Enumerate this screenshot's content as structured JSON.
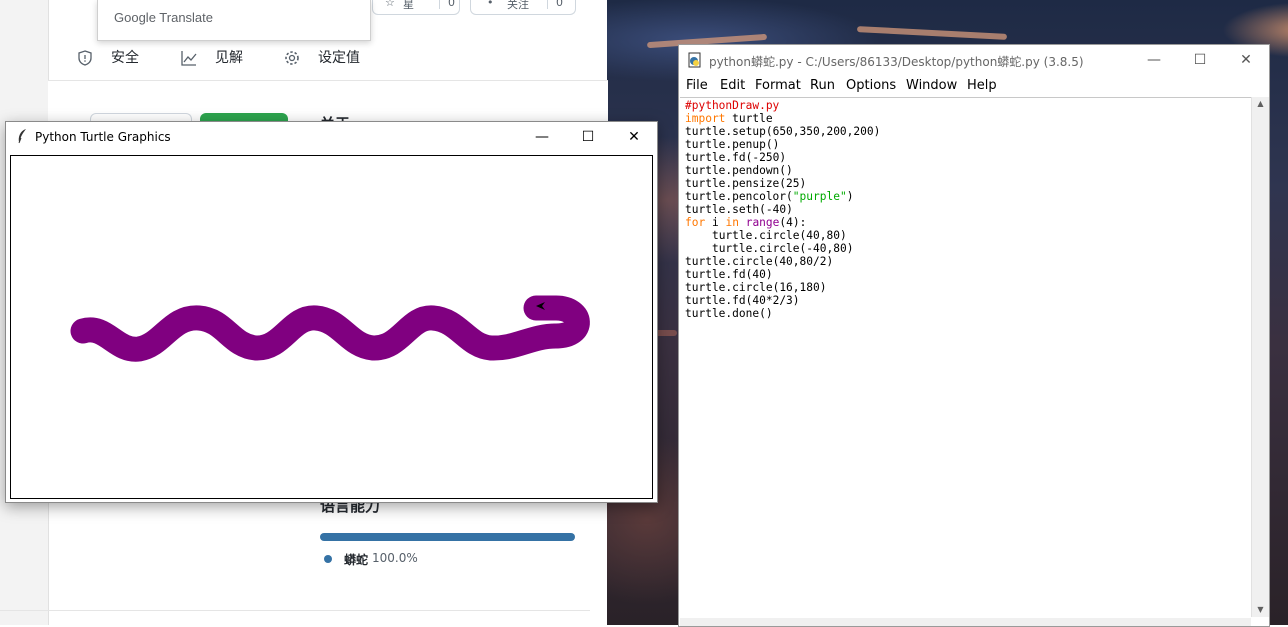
{
  "browser": {
    "translate_label": "Google Translate",
    "repo_star_label": "星",
    "repo_star_count": "0",
    "repo_watch_label": "关注",
    "repo_watch_count": "0",
    "tabs": [
      {
        "label": "安全",
        "icon": "shield-icon"
      },
      {
        "label": "见解",
        "icon": "graph-icon"
      },
      {
        "label": "设定值",
        "icon": "gear-icon"
      }
    ],
    "partial_heading": "关于",
    "languages_title": "语言能力",
    "language": {
      "name": "蟒蛇",
      "percent": "100.0%",
      "color": "#3572A5",
      "share": 1.0
    }
  },
  "turtle_window": {
    "title": "Python Turtle Graphics",
    "icon": "feather-icon",
    "pen_color": "#800080",
    "pen_size": 25
  },
  "idle_window": {
    "title": "python蟒蛇.py - C:/Users/86133/Desktop/python蟒蛇.py (3.8.5)",
    "icon": "python-file-icon",
    "menus": [
      "File",
      "Edit",
      "Format",
      "Run",
      "Options",
      "Window",
      "Help"
    ],
    "code_lines": [
      "#pythonDraw.py",
      "import turtle",
      "turtle.setup(650,350,200,200)",
      "turtle.penup()",
      "turtle.fd(-250)",
      "turtle.pendown()",
      "turtle.pensize(25)",
      "turtle.pencolor(\"purple\")",
      "turtle.seth(-40)",
      "for i in range(4):",
      "    turtle.circle(40,80)",
      "    turtle.circle(-40,80)",
      "turtle.circle(40,80/2)",
      "turtle.fd(40)",
      "turtle.circle(16,180)",
      "turtle.fd(40*2/3)",
      "turtle.done()"
    ]
  },
  "window_controls": {
    "minimize": "—",
    "maximize": "☐",
    "close": "✕"
  }
}
